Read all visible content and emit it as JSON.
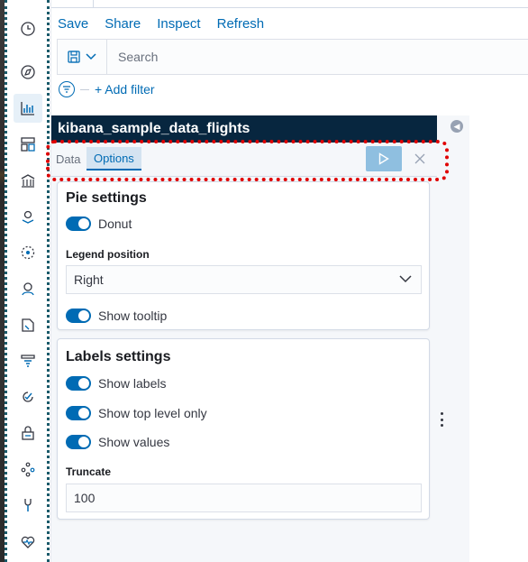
{
  "top_menu": {
    "save": "Save",
    "share": "Share",
    "inspect": "Inspect",
    "refresh": "Refresh"
  },
  "query_bar": {
    "placeholder": "Search"
  },
  "filters": {
    "add_filter": "+ Add filter"
  },
  "editor": {
    "index_pattern": "kibana_sample_data_flights",
    "tabs": {
      "data": "Data",
      "options": "Options"
    },
    "pie_settings": {
      "title": "Pie settings",
      "donut_label": "Donut",
      "legend_position_label": "Legend position",
      "legend_position_value": "Right",
      "show_tooltip_label": "Show tooltip"
    },
    "labels_settings": {
      "title": "Labels settings",
      "show_labels": "Show labels",
      "show_top_level_only": "Show top level only",
      "show_values": "Show values",
      "truncate_label": "Truncate",
      "truncate_value": "100"
    }
  },
  "nav_icons": [
    "clock-icon",
    "compass-icon",
    "visualize-icon",
    "dashboard-icon",
    "canvas-icon",
    "maps-icon",
    "ml-icon",
    "infrastructure-icon",
    "logs-icon",
    "apm-icon",
    "uptime-icon",
    "security-icon",
    "graph-icon",
    "dev-tools-icon",
    "monitoring-icon"
  ],
  "colors": {
    "accent": "#006bb4",
    "header_dark": "#07263f",
    "highlight": "#e00000"
  }
}
